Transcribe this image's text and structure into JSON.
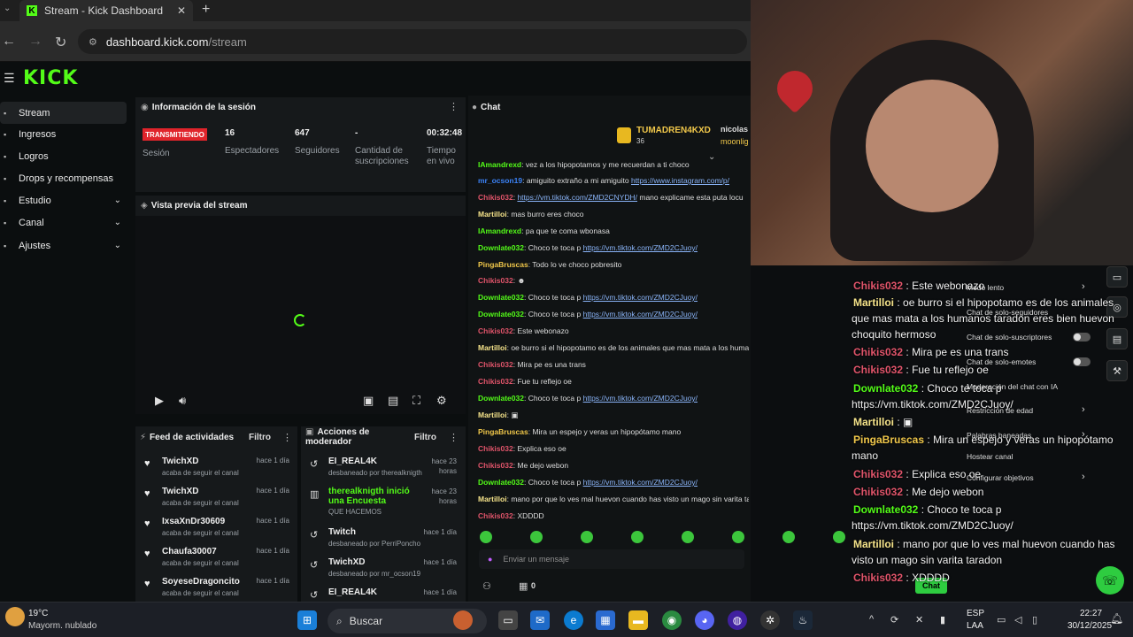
{
  "browser": {
    "tab_title": "Stream - Kick Dashboard",
    "url_host": "dashboard.kick.com",
    "url_path": "/stream"
  },
  "brand": {
    "logo": "KICK",
    "accent": "#53fc18"
  },
  "sidebar": {
    "items": [
      {
        "label": "Stream",
        "active": true
      },
      {
        "label": "Ingresos"
      },
      {
        "label": "Logros"
      },
      {
        "label": "Drops y recompensas"
      },
      {
        "label": "Estudio",
        "expandable": true
      },
      {
        "label": "Canal",
        "expandable": true
      },
      {
        "label": "Ajustes",
        "expandable": true
      }
    ]
  },
  "session": {
    "title": "Información de la sesión",
    "badge": "TRANSMITIENDO",
    "badge_label": "Sesión",
    "viewers": "16",
    "viewers_label": "Espectadores",
    "followers": "647",
    "followers_label": "Seguidores",
    "subs": "-",
    "subs_label": "Cantidad de suscripciones",
    "uptime": "00:32:48",
    "uptime_label": "Tiempo en vivo"
  },
  "preview": {
    "title": "Vista previa del stream"
  },
  "activity": {
    "title": "Feed de actividades",
    "filter": "Filtro",
    "items": [
      {
        "name": "TwichXD",
        "sub": "acaba de seguir el canal",
        "time": "hace 1 día"
      },
      {
        "name": "TwichXD",
        "sub": "acaba de seguir el canal",
        "time": "hace 1 día"
      },
      {
        "name": "IxsaXnDr30609",
        "sub": "acaba de seguir el canal",
        "time": "hace 1 día"
      },
      {
        "name": "Chaufa30007",
        "sub": "acaba de seguir el canal",
        "time": "hace 1 día"
      },
      {
        "name": "SoyeseDragoncito",
        "sub": "acaba de seguir el canal",
        "time": "hace 1 día"
      }
    ]
  },
  "modactions": {
    "title": "Acciones de moderador",
    "filter": "Filtro",
    "items": [
      {
        "name": "EI_REAL4K",
        "sub": "desbaneado por therealknigth",
        "time": "hace 23 horas"
      },
      {
        "name": "therealknigth inició una Encuesta",
        "sub": "QUE HACEMOS",
        "time": "hace 23 horas"
      },
      {
        "name": "Twitch",
        "sub": "desbaneado por PerriPoncho",
        "time": "hace 1 día"
      },
      {
        "name": "TwichXD",
        "sub": "desbaneado por mr_ocson19",
        "time": "hace 1 día"
      },
      {
        "name": "EI_REAL4K",
        "sub": "",
        "time": "hace 1 día"
      }
    ]
  },
  "chat": {
    "title": "Chat",
    "pinned_user": "TUMADREN4KXD",
    "pinned_count": "36",
    "pinned_user2": "nicolas",
    "pinned_user2b": "moonlig",
    "input_placeholder": "Enviar un mensaje",
    "footer_count": "0",
    "messages": [
      {
        "user": "IAmandrexd",
        "color": "#53fc18",
        "text": "vez a los hipopotamos y me recuerdan a ti choco"
      },
      {
        "user": "mr_ocson19",
        "color": "#3b82f6",
        "text": "amiguito extraño a mi amiguito",
        "link": "https://www.instagram.com/p/"
      },
      {
        "user": "Chikis032",
        "color": "#e0546a",
        "text": "",
        "link": "https://vm.tiktok.com/ZMD2CNYDH/",
        "text2": "mano explicame esta puta locu"
      },
      {
        "user": "Martilloi",
        "color": "#f5e38a",
        "text": "mas burro eres choco"
      },
      {
        "user": "IAmandrexd",
        "color": "#53fc18",
        "text": "pa que te coma wbonasa"
      },
      {
        "user": "Downlate032",
        "color": "#53fc18",
        "text": "Choco te toca p",
        "link": "https://vm.tiktok.com/ZMD2CJuoy/"
      },
      {
        "user": "PingaBruscas",
        "color": "#f0c74a",
        "text": "Todo lo ve choco pobresito"
      },
      {
        "user": "Chikis032",
        "color": "#e0546a",
        "text": "☻"
      },
      {
        "user": "Downlate032",
        "color": "#53fc18",
        "text": "Choco te toca p",
        "link": "https://vm.tiktok.com/ZMD2CJuoy/"
      },
      {
        "user": "Downlate032",
        "color": "#53fc18",
        "text": "Choco te toca p",
        "link": "https://vm.tiktok.com/ZMD2CJuoy/"
      },
      {
        "user": "Chikis032",
        "color": "#e0546a",
        "text": "Este webonazo"
      },
      {
        "user": "Martilloi",
        "color": "#f5e38a",
        "text": "oe burro si el hipopotamo es de los animales que mas mata a los humanos taradon eres bien huevon choquito hermoso"
      },
      {
        "user": "Chikis032",
        "color": "#e0546a",
        "text": "Mira pe es una trans"
      },
      {
        "user": "Chikis032",
        "color": "#e0546a",
        "text": "Fue tu reflejo oe"
      },
      {
        "user": "Downlate032",
        "color": "#53fc18",
        "text": "Choco te toca p",
        "link": "https://vm.tiktok.com/ZMD2CJuoy/"
      },
      {
        "user": "Martilloi",
        "color": "#f5e38a",
        "text": "▣"
      },
      {
        "user": "PingaBruscas",
        "color": "#f0c74a",
        "text": "Mira un espejo y veras un hipopótamo mano"
      },
      {
        "user": "Chikis032",
        "color": "#e0546a",
        "text": "Explica eso oe"
      },
      {
        "user": "Chikis032",
        "color": "#e0546a",
        "text": "Me dejo webon"
      },
      {
        "user": "Downlate032",
        "color": "#53fc18",
        "text": "Choco te toca p",
        "link": "https://vm.tiktok.com/ZMD2CJuoy/"
      },
      {
        "user": "Martilloi",
        "color": "#f5e38a",
        "text": "mano por que lo ves mal huevon cuando has visto un mago sin varita taradon"
      },
      {
        "user": "Chikis032",
        "color": "#e0546a",
        "text": "XDDDD"
      }
    ]
  },
  "overlay": {
    "messages": [
      {
        "user": "Chikis032",
        "color": "#e0546a",
        "text": "Este webonazo"
      },
      {
        "user": "Martilloi",
        "color": "#f5e38a",
        "text": "oe burro si el hipopotamo es de los animales"
      },
      {
        "user": "",
        "color": "#fff",
        "text": "que mas mata a los humanos taradon eres bien huevon"
      },
      {
        "user": "",
        "color": "#fff",
        "text": "choquito hermoso"
      },
      {
        "user": "Chikis032",
        "color": "#e0546a",
        "text": "Mira pe es una trans"
      },
      {
        "user": "Chikis032",
        "color": "#e0546a",
        "text": "Fue tu reflejo oe"
      },
      {
        "user": "Downlate032",
        "color": "#53fc18",
        "text": "Choco te toca p"
      },
      {
        "user": "",
        "color": "#fff",
        "text": "https://vm.tiktok.com/ZMD2CJuoy/"
      },
      {
        "user": "Martilloi",
        "color": "#f5e38a",
        "text": "▣"
      },
      {
        "user": "PingaBruscas",
        "color": "#f0c74a",
        "text": "Mira un espejo y veras un hipopótamo"
      },
      {
        "user": "",
        "color": "#fff",
        "text": "mano"
      },
      {
        "user": "Chikis032",
        "color": "#e0546a",
        "text": "Explica eso oe"
      },
      {
        "user": "Chikis032",
        "color": "#e0546a",
        "text": "Me dejo webon"
      },
      {
        "user": "Downlate032",
        "color": "#53fc18",
        "text": "Choco te toca p"
      },
      {
        "user": "",
        "color": "#fff",
        "text": "https://vm.tiktok.com/ZMD2CJuoy/"
      },
      {
        "user": "Martilloi",
        "color": "#f5e38a",
        "text": "mano por que lo ves mal huevon cuando has"
      },
      {
        "user": "",
        "color": "#fff",
        "text": "visto un mago sin varita taradon"
      },
      {
        "user": "Chikis032",
        "color": "#e0546a",
        "text": "XDDDD"
      }
    ],
    "mod_options": [
      "Modo lento",
      "Chat de solo-seguidores",
      "Chat de solo-suscriptores",
      "Chat de solo-emotes",
      "Moderación del chat con IA",
      "Restricción de edad",
      "Palabras baneadas",
      "Hostear canal",
      "Configurar objetivos"
    ],
    "chat_button": "Chat"
  },
  "taskbar": {
    "weather_temp": "19°C",
    "weather_desc": "Mayorm. nublado",
    "search": "Buscar",
    "lang": "ESP",
    "lang2": "LAA",
    "time": "22:27",
    "date": "30/12/2025"
  }
}
